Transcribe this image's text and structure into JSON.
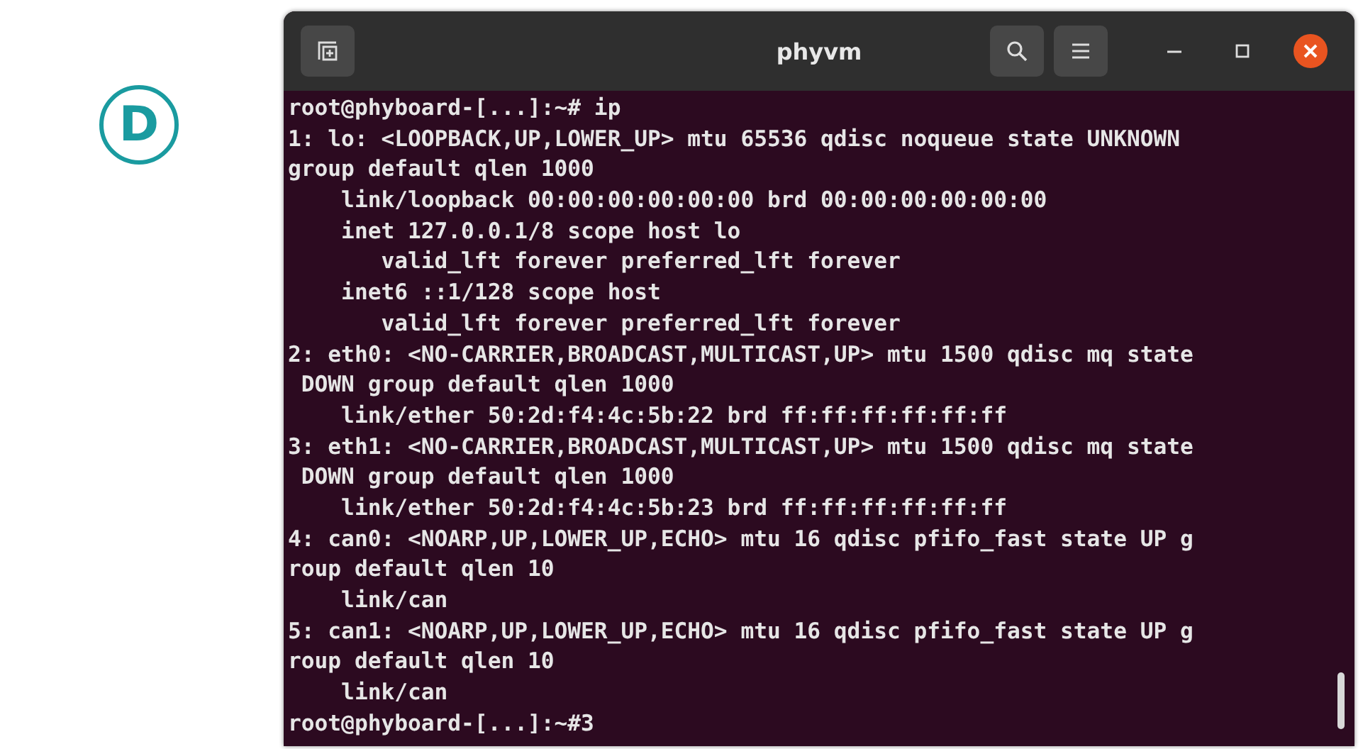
{
  "figure_label": "D",
  "window": {
    "title": "phyvm"
  },
  "terminal": {
    "lines": [
      "root@phyboard-[...]:~# ip",
      "1: lo: <LOOPBACK,UP,LOWER_UP> mtu 65536 qdisc noqueue state UNKNOWN",
      "group default qlen 1000",
      "    link/loopback 00:00:00:00:00:00 brd 00:00:00:00:00:00",
      "    inet 127.0.0.1/8 scope host lo",
      "       valid_lft forever preferred_lft forever",
      "    inet6 ::1/128 scope host",
      "       valid_lft forever preferred_lft forever",
      "2: eth0: <NO-CARRIER,BROADCAST,MULTICAST,UP> mtu 1500 qdisc mq state",
      " DOWN group default qlen 1000",
      "    link/ether 50:2d:f4:4c:5b:22 brd ff:ff:ff:ff:ff:ff",
      "3: eth1: <NO-CARRIER,BROADCAST,MULTICAST,UP> mtu 1500 qdisc mq state",
      " DOWN group default qlen 1000",
      "    link/ether 50:2d:f4:4c:5b:23 brd ff:ff:ff:ff:ff:ff",
      "4: can0: <NOARP,UP,LOWER_UP,ECHO> mtu 16 qdisc pfifo_fast state UP g",
      "roup default qlen 10",
      "    link/can",
      "5: can1: <NOARP,UP,LOWER_UP,ECHO> mtu 16 qdisc pfifo_fast state UP g",
      "roup default qlen 10",
      "    link/can",
      "root@phyboard-[...]:~#3"
    ]
  }
}
